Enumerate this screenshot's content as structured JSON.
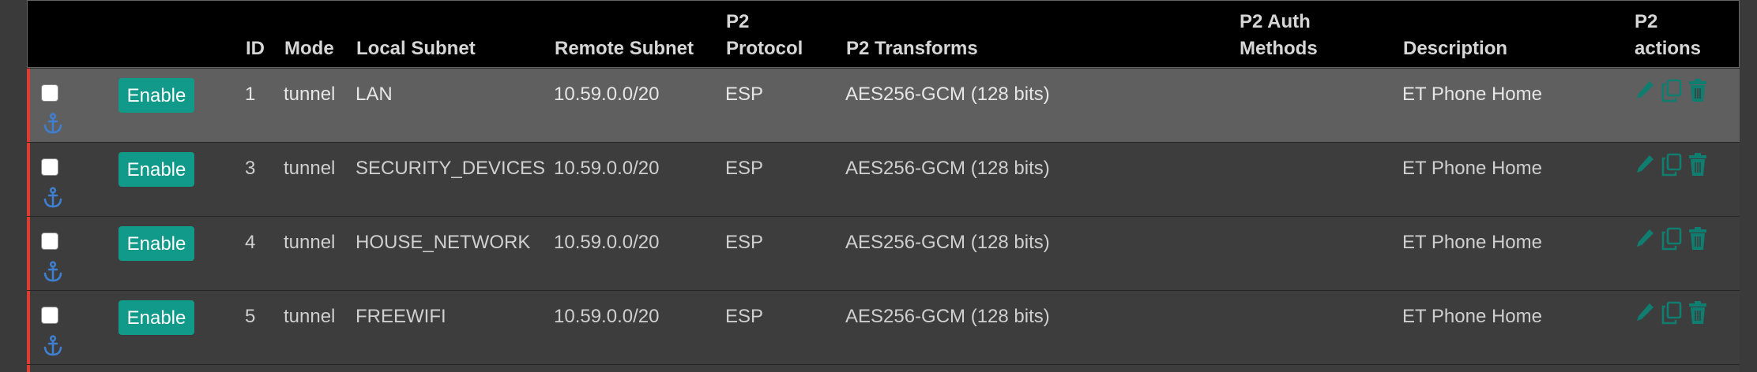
{
  "header": {
    "id": "ID",
    "mode": "Mode",
    "local_subnet": "Local Subnet",
    "remote_subnet": "Remote Subnet",
    "p2_protocol_1": "P2",
    "p2_protocol_2": "Protocol",
    "p2_transforms": "P2 Transforms",
    "p2_auth_1": "P2 Auth",
    "p2_auth_2": "Methods",
    "description": "Description",
    "p2_actions_1": "P2",
    "p2_actions_2": "actions"
  },
  "rows": [
    {
      "enable_label": "Enable",
      "id": "1",
      "mode": "tunnel",
      "local_subnet": "LAN",
      "remote_subnet": "10.59.0.0/20",
      "protocol": "ESP",
      "transforms": "AES256-GCM (128 bits)",
      "auth_methods": "",
      "description": "ET Phone Home"
    },
    {
      "enable_label": "Enable",
      "id": "3",
      "mode": "tunnel",
      "local_subnet": "SECURITY_DEVICES",
      "remote_subnet": "10.59.0.0/20",
      "protocol": "ESP",
      "transforms": "AES256-GCM (128 bits)",
      "auth_methods": "",
      "description": "ET Phone Home"
    },
    {
      "enable_label": "Enable",
      "id": "4",
      "mode": "tunnel",
      "local_subnet": "HOUSE_NETWORK",
      "remote_subnet": "10.59.0.0/20",
      "protocol": "ESP",
      "transforms": "AES256-GCM (128 bits)",
      "auth_methods": "",
      "description": "ET Phone Home"
    },
    {
      "enable_label": "Enable",
      "id": "5",
      "mode": "tunnel",
      "local_subnet": "FREEWIFI",
      "remote_subnet": "10.59.0.0/20",
      "protocol": "ESP",
      "transforms": "AES256-GCM (128 bits)",
      "auth_methods": "",
      "description": "ET Phone Home"
    }
  ],
  "icons": {
    "anchor": "anchor-icon",
    "edit": "pencil-icon",
    "copy": "copy-icon",
    "delete": "trash-icon"
  },
  "colors": {
    "enable_button": "#11998a",
    "action_icon": "#0f7d6f",
    "anchor_icon": "#3f7fd0",
    "disabled_bar": "#e03b31"
  }
}
